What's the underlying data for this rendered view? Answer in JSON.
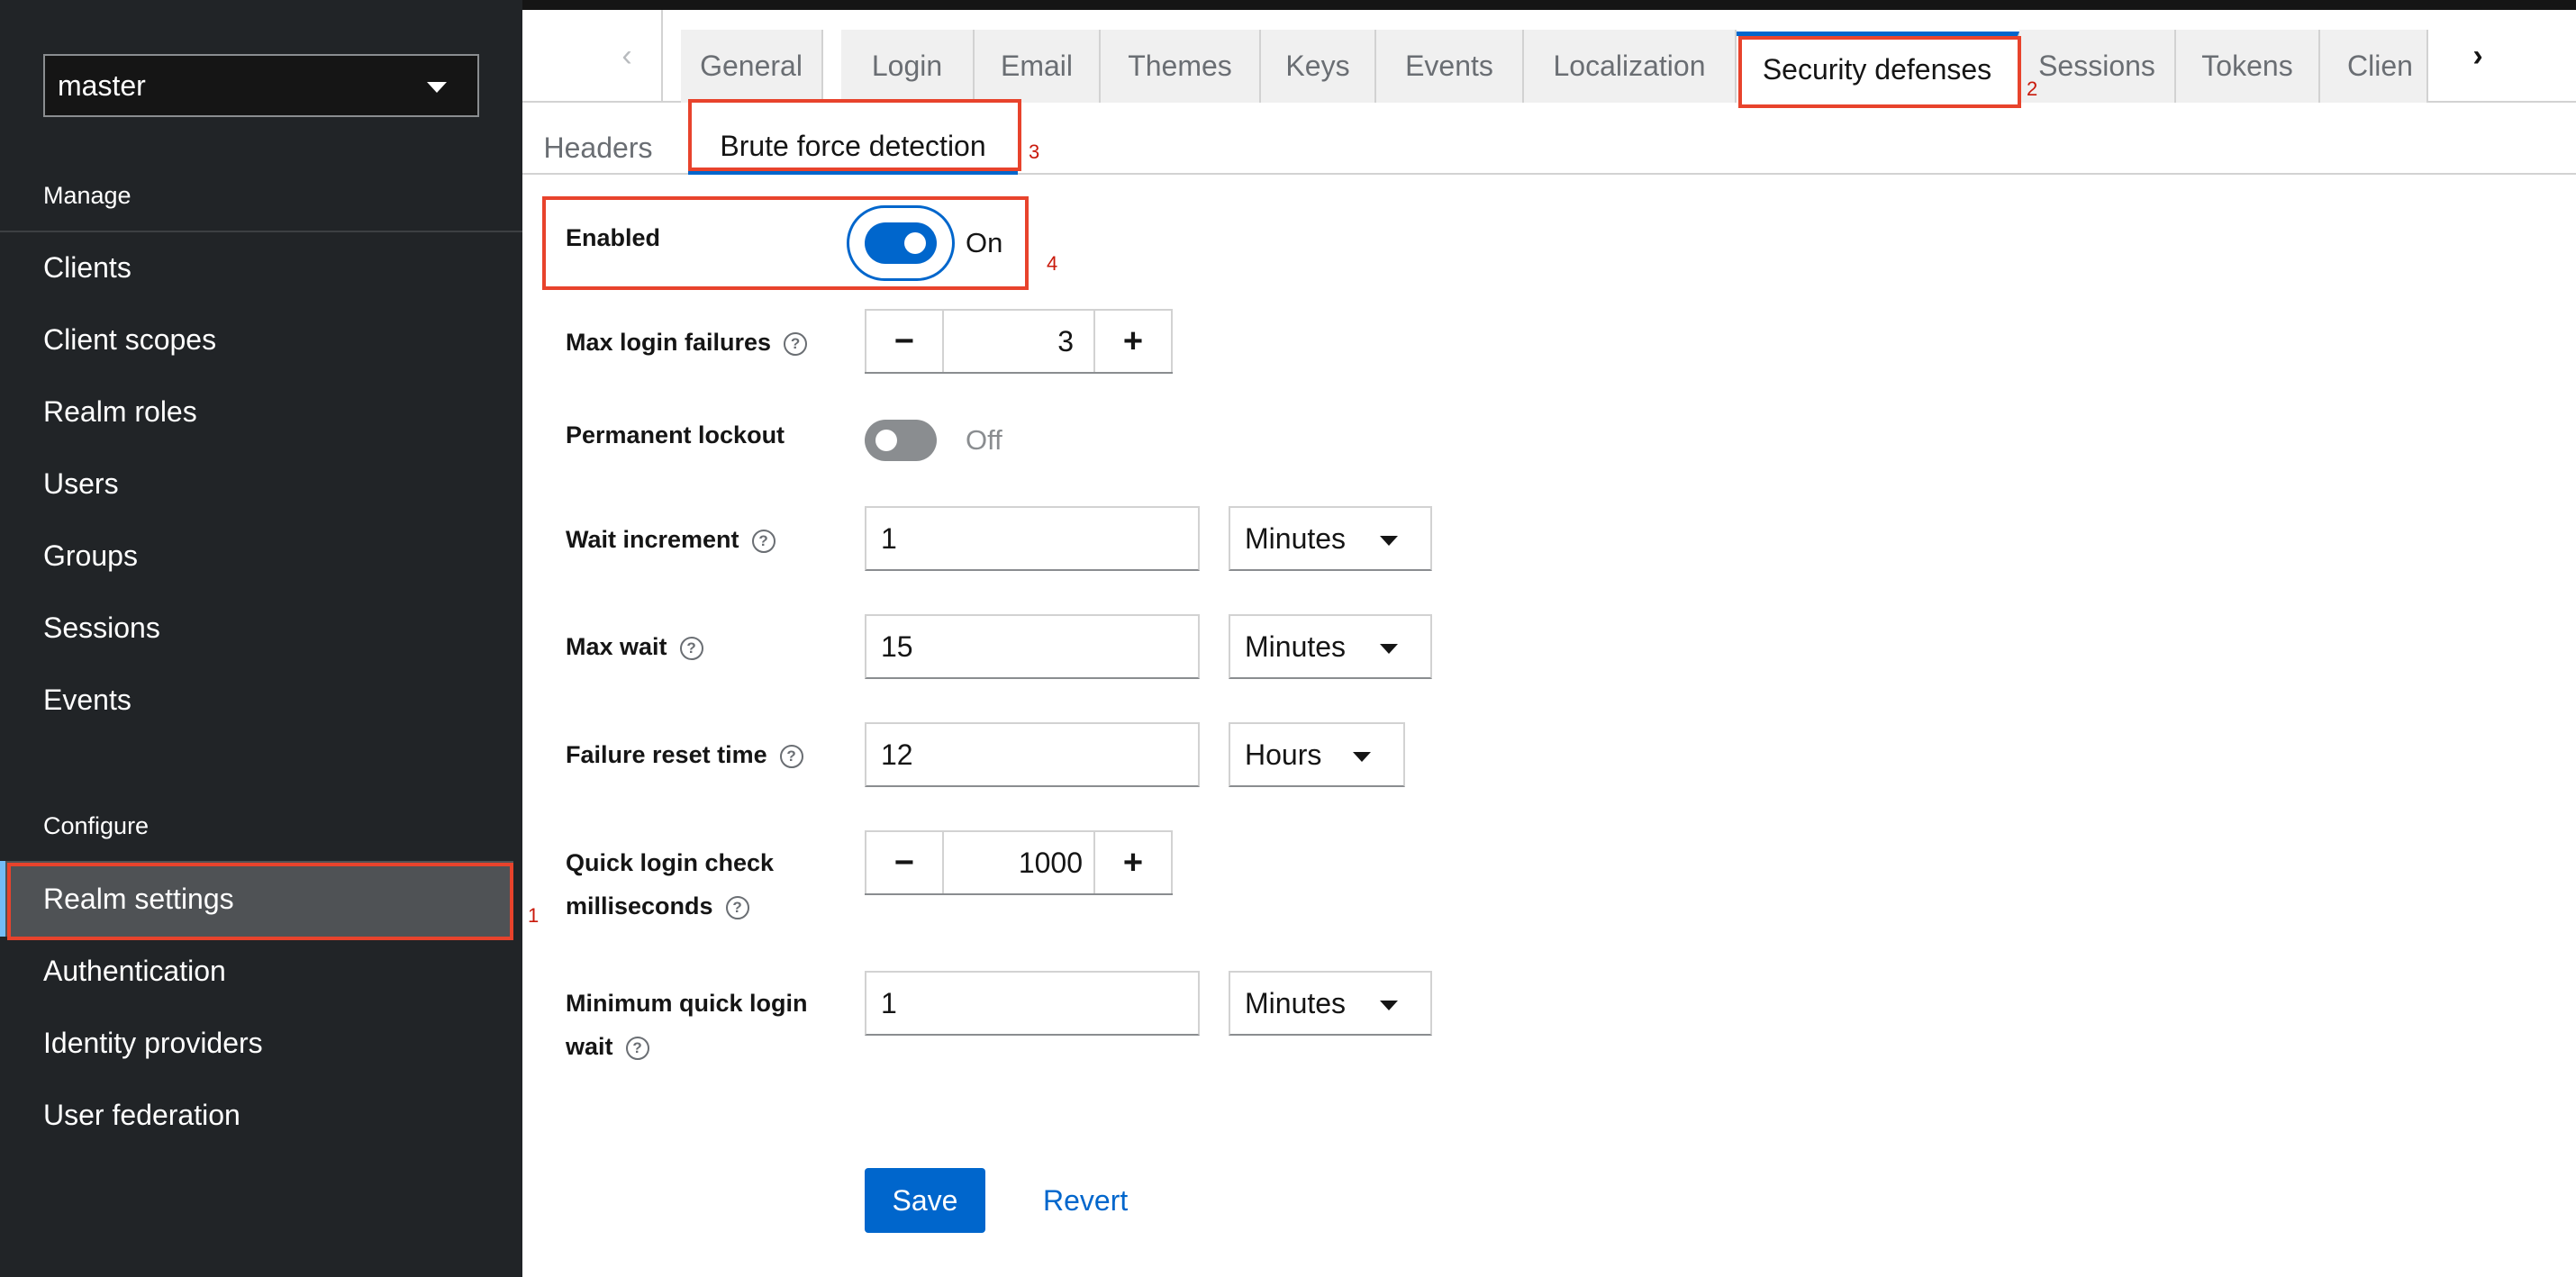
{
  "sidebar": {
    "realm": "master",
    "sections": {
      "manage": "Manage",
      "configure": "Configure"
    },
    "manage_items": [
      "Clients",
      "Client scopes",
      "Realm roles",
      "Users",
      "Groups",
      "Sessions",
      "Events"
    ],
    "configure_items": [
      "Realm settings",
      "Authentication",
      "Identity providers",
      "User federation"
    ],
    "active_item": "Realm settings"
  },
  "tabs": {
    "scroll_left": "‹",
    "scroll_right": "›",
    "items": [
      "General",
      "Login",
      "Email",
      "Themes",
      "Keys",
      "Events",
      "Localization",
      "Security defenses",
      "Sessions",
      "Tokens",
      "Clien"
    ],
    "active": "Security defenses"
  },
  "subtabs": {
    "items": [
      "Headers",
      "Brute force detection"
    ],
    "active": "Brute force detection"
  },
  "form": {
    "enabled": {
      "label": "Enabled",
      "state": "On"
    },
    "max_login_failures": {
      "label": "Max login failures",
      "value": "3"
    },
    "permanent_lockout": {
      "label": "Permanent lockout",
      "state": "Off"
    },
    "wait_increment": {
      "label": "Wait increment",
      "value": "1",
      "unit": "Minutes"
    },
    "max_wait": {
      "label": "Max wait",
      "value": "15",
      "unit": "Minutes"
    },
    "failure_reset_time": {
      "label": "Failure reset time",
      "value": "12",
      "unit": "Hours"
    },
    "quick_login_check": {
      "label_line1": "Quick login check",
      "label_line2": "milliseconds",
      "value": "1000"
    },
    "min_quick_login_wait": {
      "label_line1": "Minimum quick login",
      "label_line2": "wait",
      "value": "1",
      "unit": "Minutes"
    },
    "help_glyph": "?",
    "minus": "−",
    "plus": "+"
  },
  "actions": {
    "save": "Save",
    "revert": "Revert"
  },
  "annotations": [
    "1",
    "2",
    "3",
    "4"
  ],
  "colors": {
    "sidebar_bg": "#212427",
    "accent": "#0066cc",
    "annotation": "#e8432c"
  }
}
